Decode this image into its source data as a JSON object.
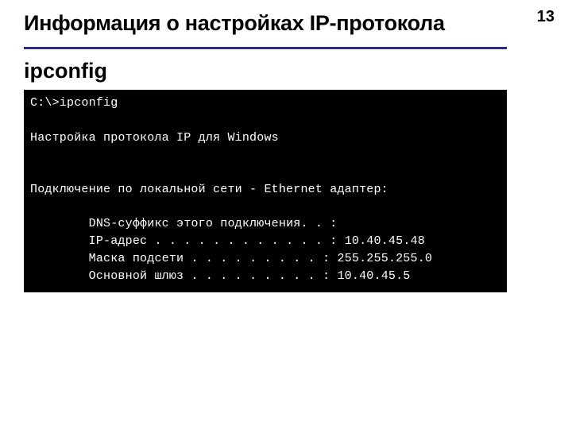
{
  "page_number": "13",
  "title": "Информация о настройках IP-протокола",
  "subtitle": "ipconfig",
  "terminal": {
    "prompt": "C:\\>ipconfig",
    "heading": "Настройка протокола IP для Windows",
    "adapter": "Подключение по локальной сети - Ethernet адаптер:",
    "rows": [
      {
        "label": "DNS-суффикс этого подключения",
        "dots": ". . :",
        "value": ""
      },
      {
        "label": "IP-адрес",
        "dots": ". . . . . . . . . . . . :",
        "value": "10.40.45.48"
      },
      {
        "label": "Маска подсети",
        "dots": ". . . . . . . . . :",
        "value": "255.255.255.0"
      },
      {
        "label": "Основной шлюз",
        "dots": ". . . . . . . . . :",
        "value": "10.40.45.5"
      }
    ]
  }
}
